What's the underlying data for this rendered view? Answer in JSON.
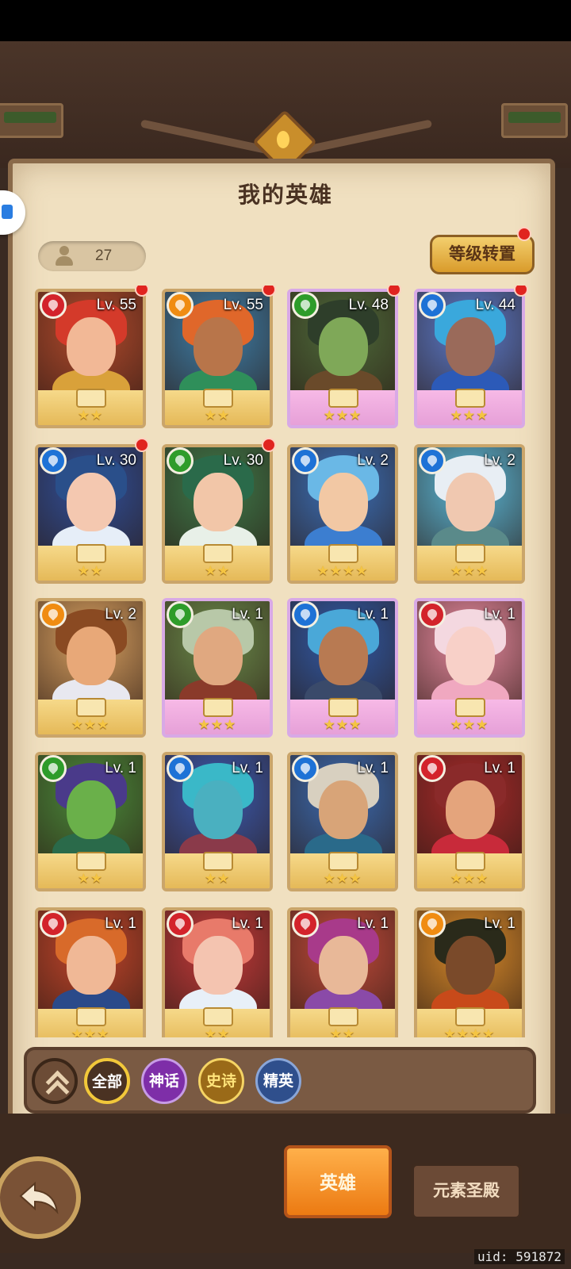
{
  "header": {
    "title": "我的英雄"
  },
  "toolbar": {
    "hero_count": "27",
    "level_transfer": "等级转置"
  },
  "colors": {
    "fire": "#d3232b",
    "water": "#1e72d6",
    "nature": "#2e9c2a",
    "light": "#f08c12",
    "panel": "#f0e0c0"
  },
  "heroes": [
    {
      "level": "Lv. 55",
      "element": "fire",
      "stars": "★★",
      "mythic": false,
      "dot": true,
      "hair": "#d43a2a",
      "skin": "#f2b896",
      "body": "#d9a13a",
      "bg": "#b24a2c"
    },
    {
      "level": "Lv. 55",
      "element": "light",
      "stars": "★★",
      "mythic": false,
      "dot": true,
      "hair": "#e0672a",
      "skin": "#b8754a",
      "body": "#2f8f5a",
      "bg": "#3d7ea8"
    },
    {
      "level": "Lv. 48",
      "element": "nature",
      "stars": "★★★",
      "mythic": true,
      "dot": true,
      "hair": "#2e3e2a",
      "skin": "#7fa858",
      "body": "#6a4a2a",
      "bg": "#4d6a3a"
    },
    {
      "level": "Lv. 44",
      "element": "water",
      "stars": "★★★",
      "mythic": true,
      "dot": true,
      "hair": "#3aa8dc",
      "skin": "#9a6a5a",
      "body": "#2c5ab8",
      "bg": "#5a7acb"
    },
    {
      "level": "Lv. 30",
      "element": "water",
      "stars": "★★",
      "mythic": false,
      "dot": true,
      "hair": "#2a4f8a",
      "skin": "#f4c8b0",
      "body": "#e6eef8",
      "bg": "#2f4f9a"
    },
    {
      "level": "Lv. 30",
      "element": "nature",
      "stars": "★★",
      "mythic": false,
      "dot": true,
      "hair": "#2a6a4a",
      "skin": "#f2c6a8",
      "body": "#e8f0e8",
      "bg": "#3e7a4a"
    },
    {
      "level": "Lv. 2",
      "element": "water",
      "stars": "★★★★",
      "mythic": false,
      "dot": false,
      "hair": "#6ab8e6",
      "skin": "#f2c8a4",
      "body": "#3c7ed0",
      "bg": "#3a6fb8"
    },
    {
      "level": "Lv. 2",
      "element": "water",
      "stars": "★★★",
      "mythic": false,
      "dot": false,
      "hair": "#e8eef4",
      "skin": "#f0c8b0",
      "body": "#5a8a8a",
      "bg": "#5ab8d8"
    },
    {
      "level": "Lv. 2",
      "element": "light",
      "stars": "★★★",
      "mythic": false,
      "dot": false,
      "hair": "#8a4a22",
      "skin": "#e8a878",
      "body": "#e8e8f0",
      "bg": "#d8a060"
    },
    {
      "level": "Lv. 1",
      "element": "nature",
      "stars": "★★★",
      "mythic": true,
      "dot": false,
      "hair": "#b8c8a8",
      "skin": "#e0a880",
      "body": "#8a3a2a",
      "bg": "#6a8a4a"
    },
    {
      "level": "Lv. 1",
      "element": "water",
      "stars": "★★★",
      "mythic": true,
      "dot": false,
      "hair": "#4aa8d8",
      "skin": "#b87a52",
      "body": "#3a4a6a",
      "bg": "#2f5aa8"
    },
    {
      "level": "Lv. 1",
      "element": "fire",
      "stars": "★★★",
      "mythic": true,
      "dot": false,
      "hair": "#f4d8e0",
      "skin": "#f8d0c8",
      "body": "#f0a8c0",
      "bg": "#e88aa0"
    },
    {
      "level": "Lv. 1",
      "element": "nature",
      "stars": "★★",
      "mythic": false,
      "dot": false,
      "hair": "#4a3a8a",
      "skin": "#6ab04a",
      "body": "#2a6a4a",
      "bg": "#4a8a3a"
    },
    {
      "level": "Lv. 1",
      "element": "water",
      "stars": "★★",
      "mythic": false,
      "dot": false,
      "hair": "#3ab8c8",
      "skin": "#4ab0c0",
      "body": "#8a3a4a",
      "bg": "#3a5ab0"
    },
    {
      "level": "Lv. 1",
      "element": "water",
      "stars": "★★★",
      "mythic": false,
      "dot": false,
      "hair": "#d8d0c0",
      "skin": "#d8a478",
      "body": "#2a6a8a",
      "bg": "#3a6ab0"
    },
    {
      "level": "Lv. 1",
      "element": "fire",
      "stars": "★★★",
      "mythic": false,
      "dot": false,
      "hair": "#8a2a2a",
      "skin": "#e4a47c",
      "body": "#c82a3a",
      "bg": "#a82a2a"
    },
    {
      "level": "Lv. 1",
      "element": "fire",
      "stars": "★★★",
      "mythic": false,
      "dot": false,
      "hair": "#d86a2a",
      "skin": "#f0b896",
      "body": "#2a4a8a",
      "bg": "#c2452a"
    },
    {
      "level": "Lv. 1",
      "element": "fire",
      "stars": "★★",
      "mythic": false,
      "dot": false,
      "hair": "#e87a6a",
      "skin": "#f4c4b0",
      "body": "#e8f0f8",
      "bg": "#c43a3a"
    },
    {
      "level": "Lv. 1",
      "element": "fire",
      "stars": "★★",
      "mythic": false,
      "dot": false,
      "hair": "#a83a8a",
      "skin": "#e8b898",
      "body": "#8a4aa8",
      "bg": "#c04a3a"
    },
    {
      "level": "Lv. 1",
      "element": "light",
      "stars": "★★★★",
      "mythic": false,
      "dot": false,
      "hair": "#2a2a1a",
      "skin": "#7a4a2a",
      "body": "#c84a1a",
      "bg": "#d88a2a"
    }
  ],
  "filters": {
    "all": "全部",
    "mythic": "神话",
    "epic": "史诗",
    "elite": "精英"
  },
  "tabs": {
    "heroes": "英雄",
    "temple": "元素圣殿"
  },
  "footer": {
    "uid": "uid: 591872"
  }
}
